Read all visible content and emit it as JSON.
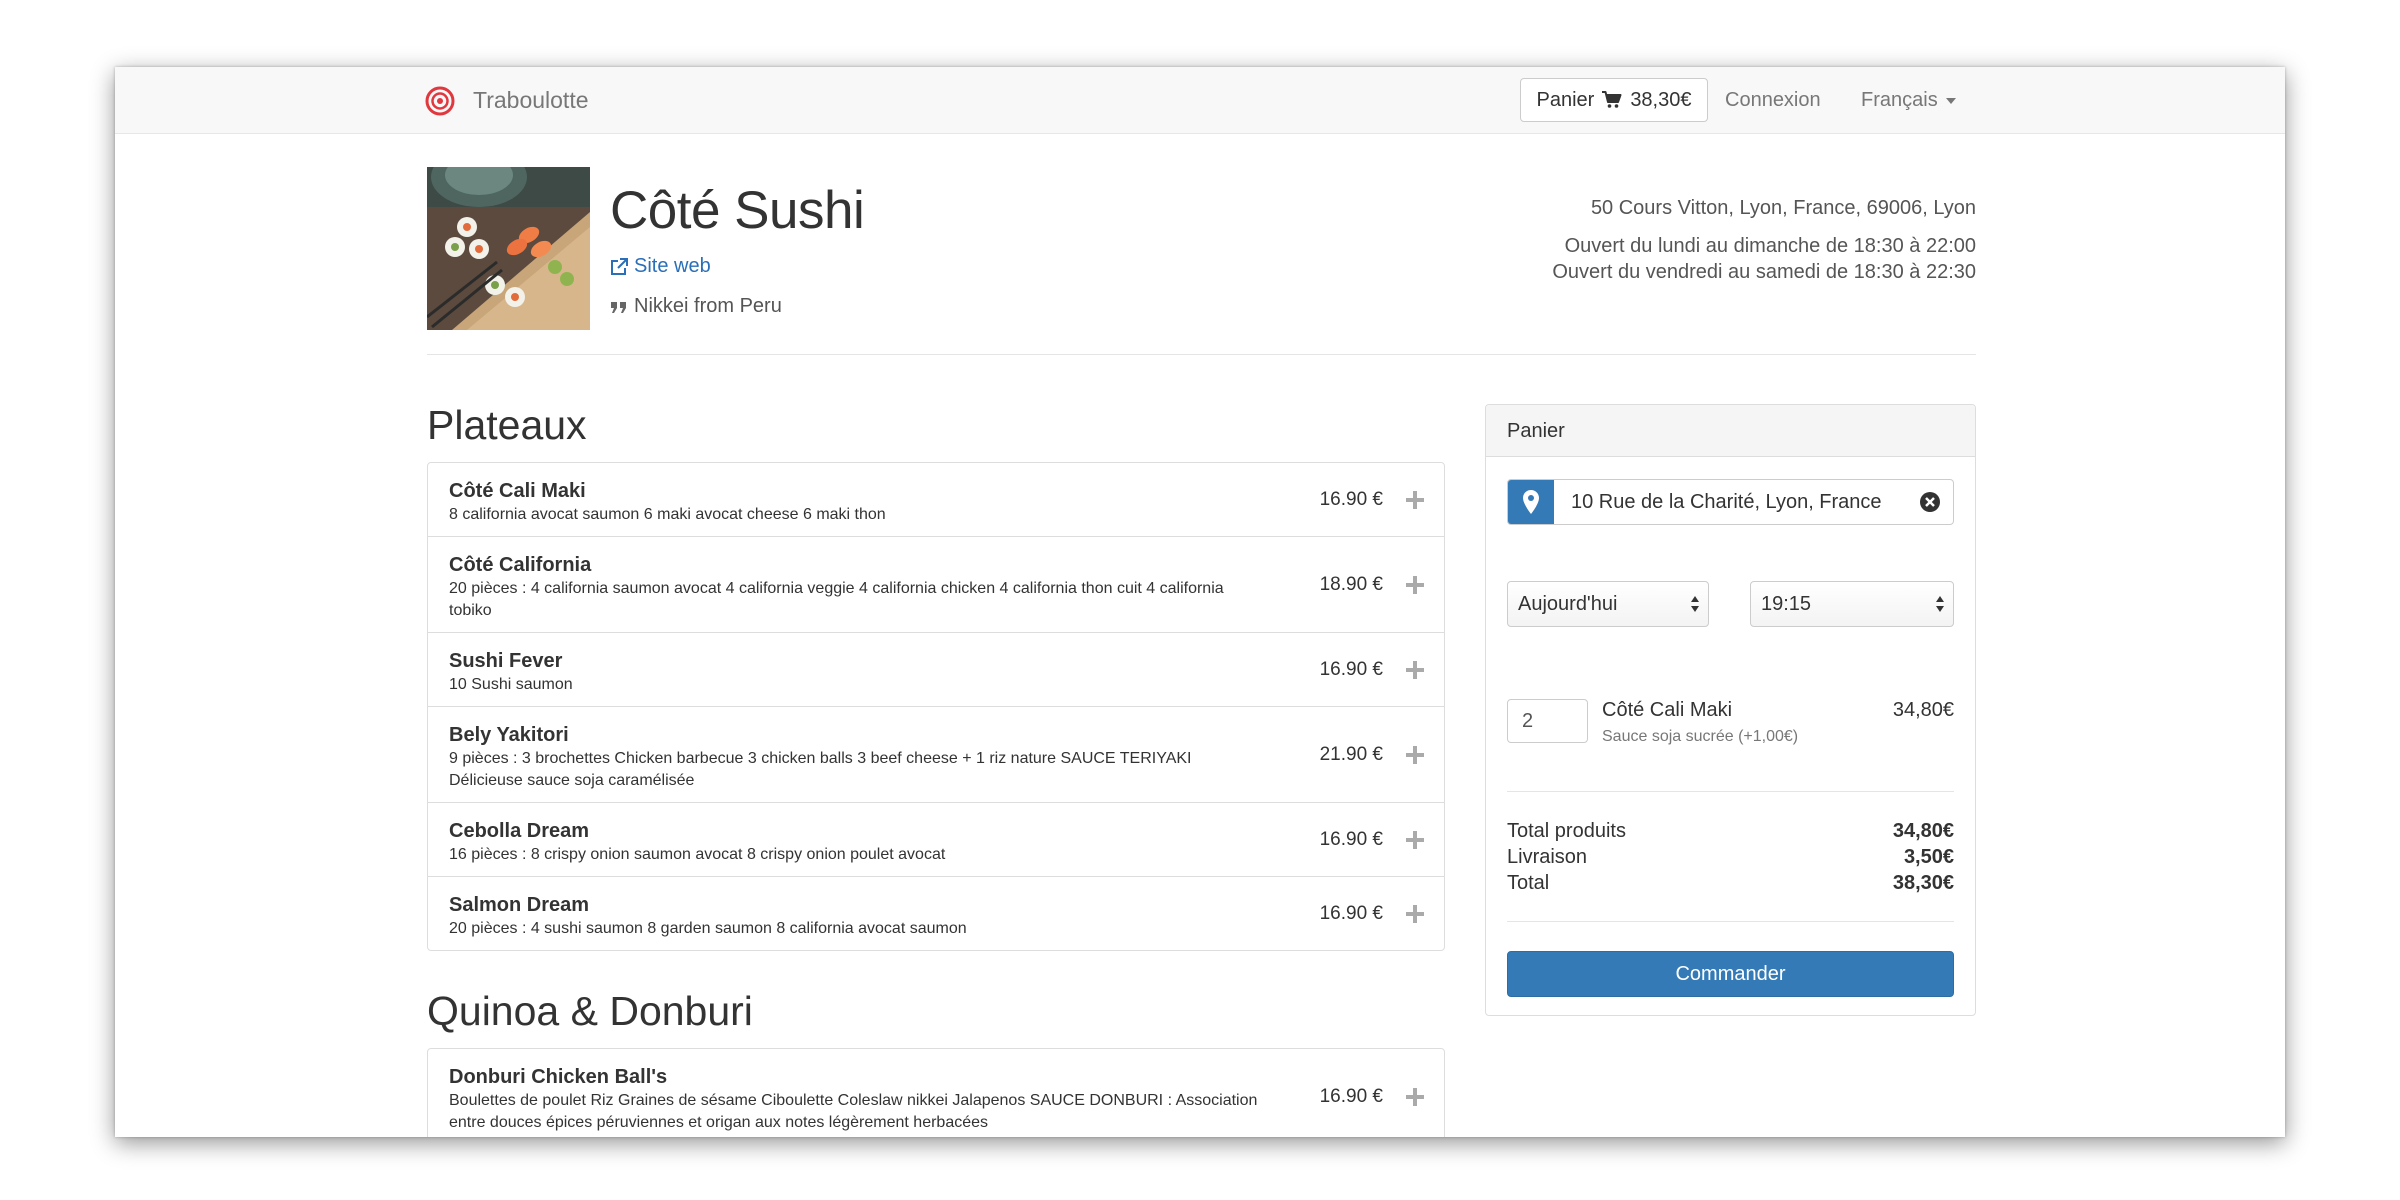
{
  "navbar": {
    "brand": "Traboulotte",
    "cart_label": "Panier",
    "cart_total": "38,30€",
    "login": "Connexion",
    "language": "Français"
  },
  "restaurant": {
    "name": "Côté Sushi",
    "website_label": "Site web",
    "tagline": "Nikkei from Peru",
    "address": "50 Cours Vitton, Lyon, France, 69006, Lyon",
    "hours": [
      "Ouvert du lundi au dimanche de 18:30 à 22:00",
      "Ouvert du vendredi au samedi de 18:30 à 22:30"
    ]
  },
  "menu": {
    "sections": [
      {
        "title": "Plateaux",
        "items": [
          {
            "name": "Côté Cali Maki",
            "description": "8 california avocat saumon 6 maki avocat cheese 6 maki thon",
            "price": "16.90 €"
          },
          {
            "name": "Côté California",
            "description": "20 pièces : 4 california saumon avocat 4 california veggie 4 california chicken 4 california thon cuit 4 california tobiko",
            "price": "18.90 €"
          },
          {
            "name": "Sushi Fever",
            "description": "10 Sushi saumon",
            "price": "16.90 €"
          },
          {
            "name": "Bely Yakitori",
            "description": "9 pièces : 3 brochettes Chicken barbecue 3 chicken balls 3 beef cheese + 1 riz nature SAUCE TERIYAKI Délicieuse sauce soja caramélisée",
            "price": "21.90 €"
          },
          {
            "name": "Cebolla Dream",
            "description": "16 pièces : 8 crispy onion saumon avocat 8 crispy onion poulet avocat",
            "price": "16.90 €"
          },
          {
            "name": "Salmon Dream",
            "description": "20 pièces : 4 sushi saumon 8 garden saumon 8 california avocat saumon",
            "price": "16.90 €"
          }
        ]
      },
      {
        "title": "Quinoa & Donburi",
        "items": [
          {
            "name": "Donburi Chicken Ball's",
            "description": "Boulettes de poulet Riz Graines de sésame Ciboulette Coleslaw nikkei Jalapenos SAUCE DONBURI : Association entre douces épices péruviennes et origan aux notes légèrement herbacées",
            "price": "16.90 €"
          }
        ]
      }
    ]
  },
  "cart": {
    "heading": "Panier",
    "address": "10 Rue de la Charité, Lyon, France",
    "date": "Aujourd'hui",
    "time": "19:15",
    "line": {
      "quantity": "2",
      "name": "Côté Cali Maki",
      "option": "Sauce soja sucrée (+1,00€)",
      "price": "34,80€"
    },
    "totals": {
      "products_label": "Total produits",
      "products_value": "34,80€",
      "delivery_label": "Livraison",
      "delivery_value": "3,50€",
      "total_label": "Total",
      "total_value": "38,30€"
    },
    "order_button": "Commander"
  },
  "colors": {
    "primary": "#337ab7",
    "link": "#2a6fb8",
    "brand_red": "#e0383e"
  },
  "icons": {
    "brand": "traboulotte-logo",
    "cart": "cart-icon",
    "website": "external-link-icon",
    "quote": "quote-icon",
    "add": "plus-icon",
    "address": "map-marker-icon",
    "clear": "clear-circle-icon"
  }
}
